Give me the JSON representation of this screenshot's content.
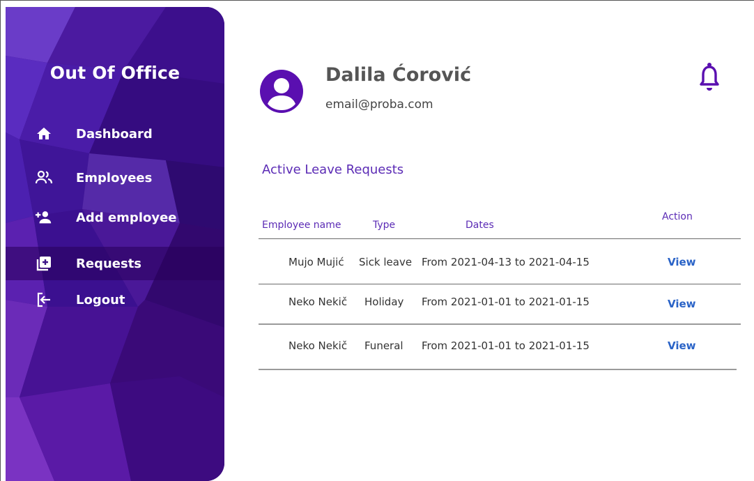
{
  "app": {
    "title": "Out Of Office"
  },
  "sidebar": {
    "items": [
      {
        "label": "Dashboard",
        "icon": "home-icon"
      },
      {
        "label": "Employees",
        "icon": "people-icon"
      },
      {
        "label": "Add employee",
        "icon": "add-person-icon"
      },
      {
        "label": "Requests",
        "icon": "add-box-icon",
        "active": true
      },
      {
        "label": "Logout",
        "icon": "logout-icon"
      }
    ]
  },
  "user": {
    "name": "Dalila Ćorović",
    "email": "email@proba.com",
    "avatar_icon": "account-circle-icon"
  },
  "notifications": {
    "icon": "bell-icon"
  },
  "requests": {
    "title": "Active Leave Requests",
    "columns": {
      "name": "Employee name",
      "type": "Type",
      "dates": "Dates",
      "action": "Action"
    },
    "rows": [
      {
        "name": "Mujo Mujić",
        "type": "Sick leave",
        "dates": "From 2021-04-13 to 2021-04-15",
        "action": "View"
      },
      {
        "name": "Neko Nekič",
        "type": "Holiday",
        "dates": "From 2021-01-01 to 2021-01-15",
        "action": "View"
      },
      {
        "name": "Neko Nekič",
        "type": "Funeral",
        "dates": "From 2021-01-01 to 2021-01-15",
        "action": "View"
      }
    ]
  },
  "colors": {
    "accent": "#5b2bb5",
    "brand_dark": "#3d1488",
    "link": "#2a63c7",
    "bell": "#5a0fb0"
  }
}
